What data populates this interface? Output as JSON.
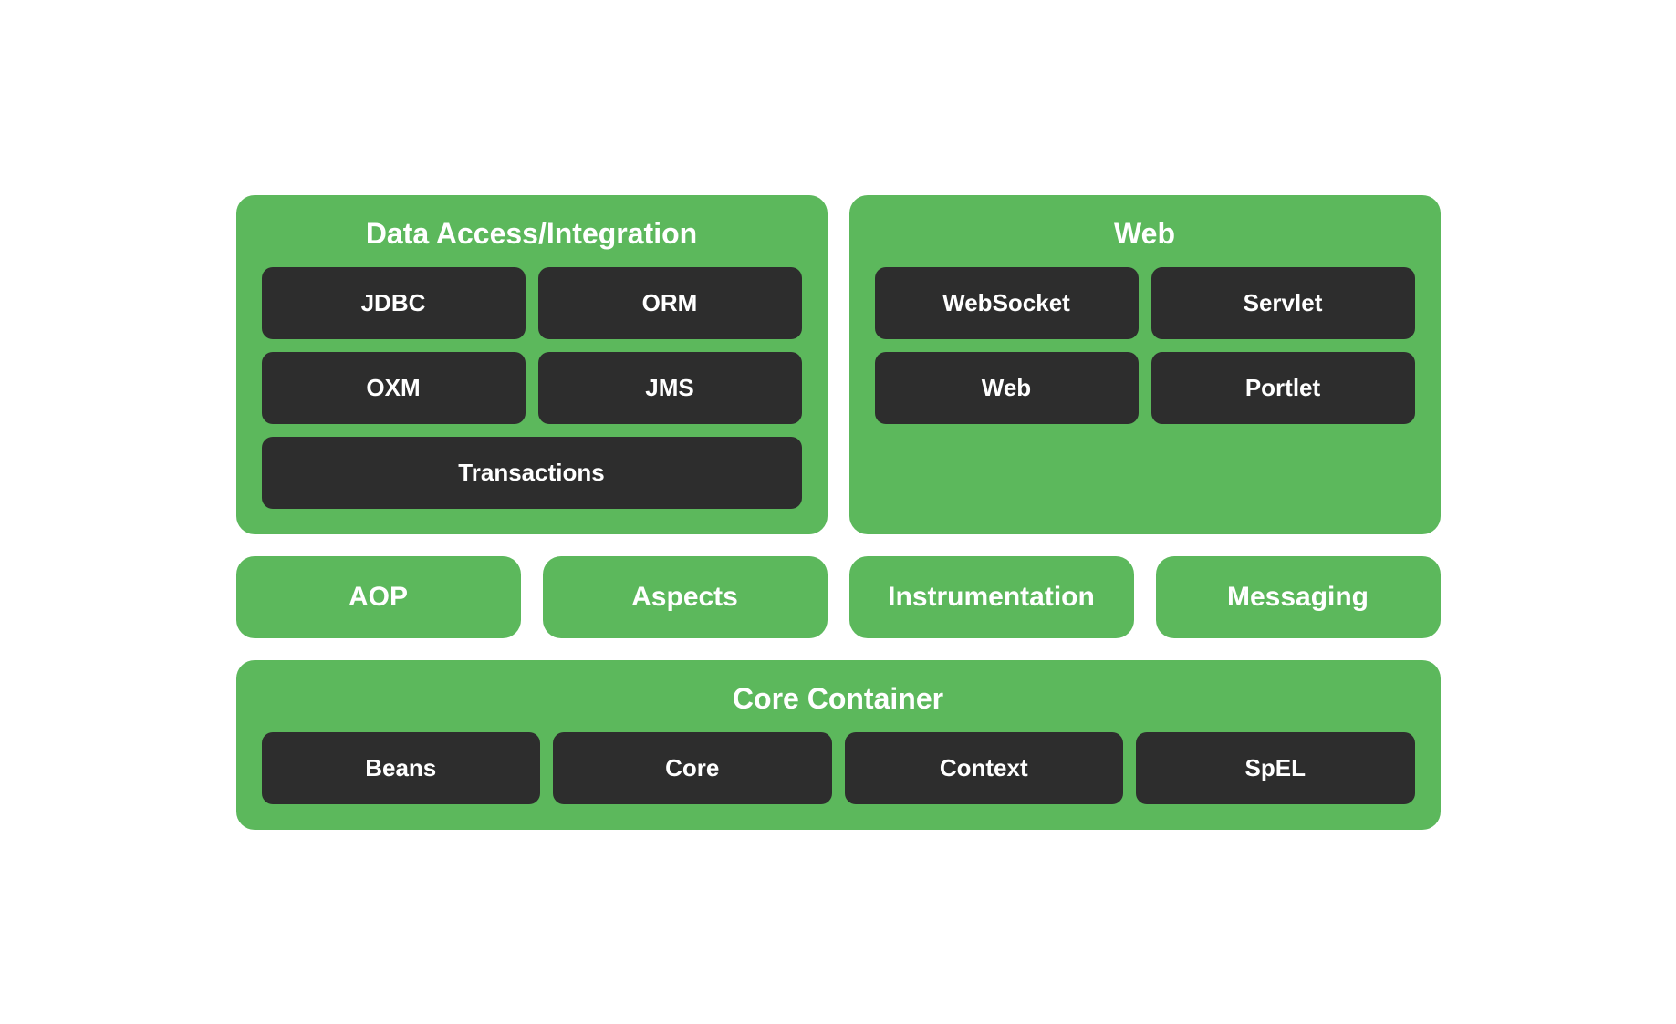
{
  "dataAccess": {
    "title": "Data Access/Integration",
    "modules": [
      "JDBC",
      "ORM",
      "OXM",
      "JMS",
      "Transactions"
    ]
  },
  "web": {
    "title": "Web",
    "modules": [
      "WebSocket",
      "Servlet",
      "Web",
      "Portlet"
    ]
  },
  "middleLeft": {
    "aop": "AOP",
    "aspects": "Aspects"
  },
  "middleRight": {
    "instrumentation": "Instrumentation",
    "messaging": "Messaging"
  },
  "coreContainer": {
    "title": "Core Container",
    "modules": [
      "Beans",
      "Core",
      "Context",
      "SpEL"
    ]
  }
}
